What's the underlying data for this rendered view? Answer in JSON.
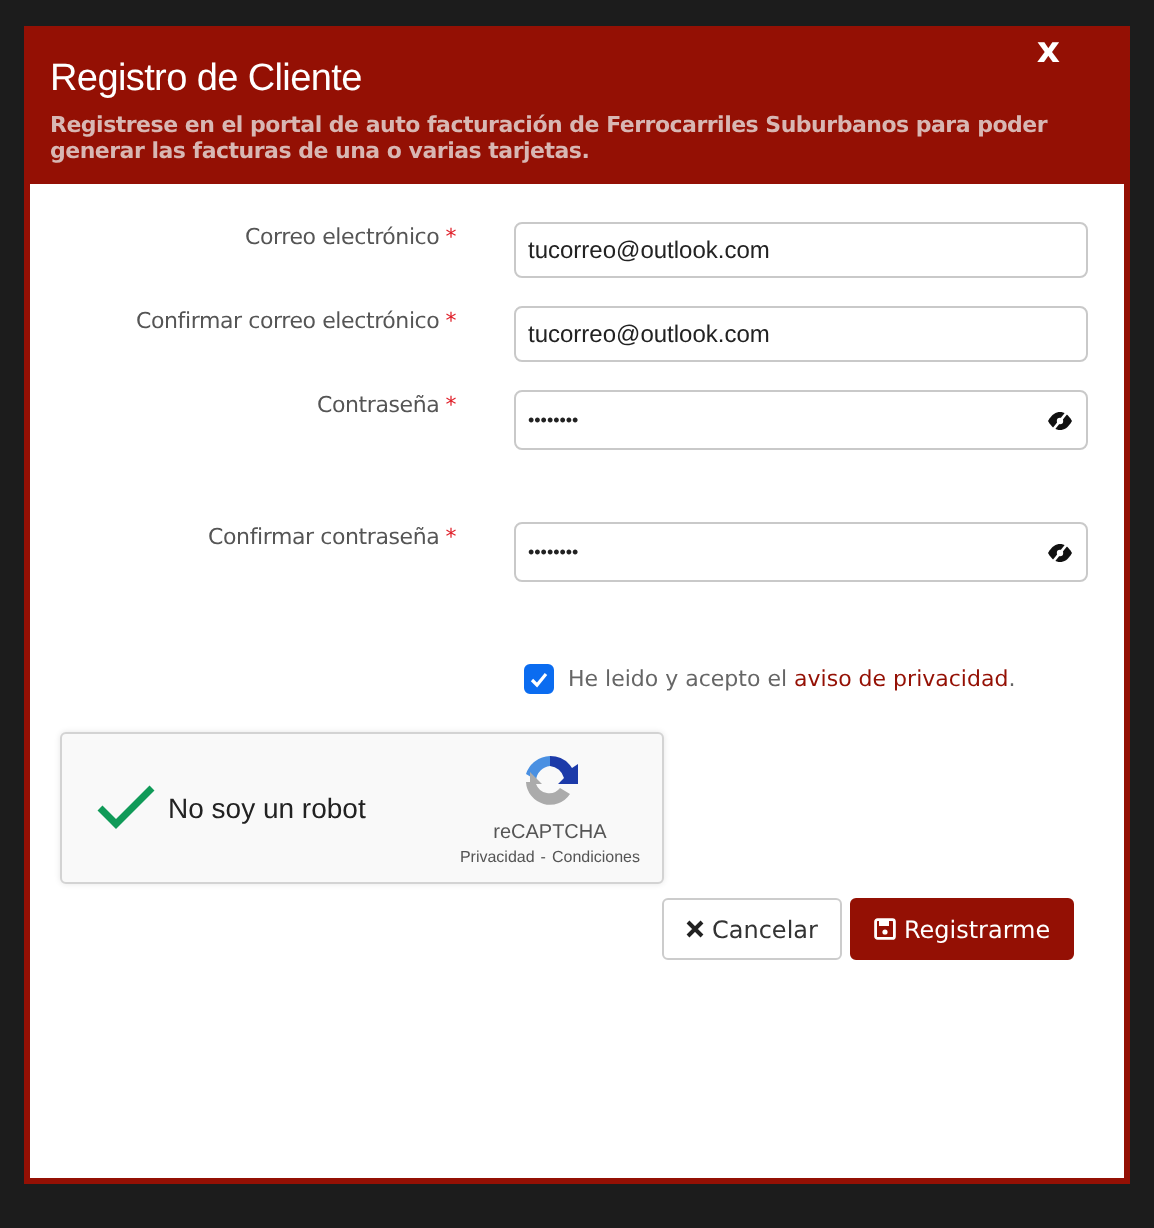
{
  "dialog": {
    "title": "Registro de Cliente",
    "subtitle": "Registrese en el portal de auto facturación de Ferrocarriles Suburbanos para poder generar las facturas de una o varias tarjetas.",
    "close": "x"
  },
  "fields": [
    {
      "label": "Correo electrónico",
      "required": "*",
      "value": "tucorreo@outlook.com",
      "kind": "text"
    },
    {
      "label": "Confirmar correo electrónico",
      "required": "*",
      "value": "tucorreo@outlook.com",
      "kind": "text"
    },
    {
      "label": "Contraseña",
      "required": "*",
      "value": "••••••••",
      "kind": "password"
    },
    {
      "label": "Confirmar contraseña",
      "required": "*",
      "value": "••••••••",
      "kind": "password"
    }
  ],
  "consent": {
    "checked": true,
    "text": "He leido y acepto el",
    "link": "aviso de privacidad",
    "end": "."
  },
  "captcha": {
    "checked": true,
    "label": "No soy un robot",
    "brand": "reCAPTCHA",
    "links": [
      "Privacidad",
      "Condiciones"
    ],
    "separator": "-"
  },
  "buttons": [
    {
      "label": "Cancelar",
      "kind": "cancel"
    },
    {
      "label": "Registrarme",
      "kind": "primary"
    }
  ]
}
